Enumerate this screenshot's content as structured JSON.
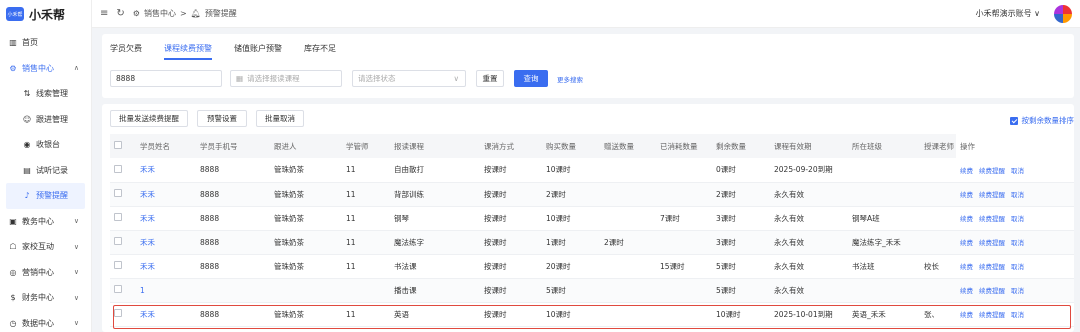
{
  "app": {
    "logo_mark": "小禾帮",
    "name": "小禾帮"
  },
  "sidebar": {
    "items": [
      {
        "label": "首页",
        "icon": "chart-icon"
      },
      {
        "label": "销售中心",
        "icon": "gear-icon",
        "expanded": true
      },
      {
        "label": "线索管理",
        "icon": "clue-icon"
      },
      {
        "label": "跟进管理",
        "icon": "user-icon"
      },
      {
        "label": "收银台",
        "icon": "cashier-icon"
      },
      {
        "label": "试听记录",
        "icon": "record-icon"
      },
      {
        "label": "预警提醒",
        "icon": "bell-icon",
        "active": true
      },
      {
        "label": "教务中心",
        "icon": "book-icon"
      },
      {
        "label": "家校互动",
        "icon": "chat-icon"
      },
      {
        "label": "营销中心",
        "icon": "marketing-icon"
      },
      {
        "label": "财务中心",
        "icon": "finance-icon"
      },
      {
        "label": "数据中心",
        "icon": "data-icon"
      }
    ]
  },
  "topbar": {
    "breadcrumb": [
      "销售中心",
      ">",
      "预警提醒"
    ],
    "account": "小禾帮演示账号 ∨"
  },
  "tabs": [
    "学员欠费",
    "课程续费预警",
    "储值账户预警",
    "库存不足"
  ],
  "active_tab": "课程续费预警",
  "filters": {
    "keyword_value": "8888",
    "course_placeholder": "请选择报读课程",
    "status_placeholder": "请选择状态",
    "reset_label": "重置",
    "search_label": "查询",
    "more_label": "更多搜索"
  },
  "actions": {
    "batch_send": "批量发送续费提醒",
    "warning_settings": "预警设置",
    "batch_cancel": "批量取消",
    "sort_label": "按剩余数量排序"
  },
  "table": {
    "columns": [
      "学员姓名",
      "学员手机号",
      "跟进人",
      "学管师",
      "报读课程",
      "课消方式",
      "购买数量",
      "赠送数量",
      "已消耗数量",
      "剩余数量",
      "课程有效期",
      "所在班级",
      "授课老师",
      "操作"
    ],
    "rows": [
      {
        "name": "禾禾",
        "phone": "8888",
        "follower": "管珠奶茶",
        "manager": "11",
        "course": "自由散打",
        "mode": "按课时",
        "bought": "10课时",
        "gift": "",
        "used": "",
        "left": "0课时",
        "valid": "2025-09-20到期",
        "class": "",
        "teacher": ""
      },
      {
        "name": "禾禾",
        "phone": "8888",
        "follower": "管珠奶茶",
        "manager": "11",
        "course": "背部训练",
        "mode": "按课时",
        "bought": "2课时",
        "gift": "",
        "used": "",
        "left": "2课时",
        "valid": "永久有效",
        "class": "",
        "teacher": ""
      },
      {
        "name": "禾禾",
        "phone": "8888",
        "follower": "管珠奶茶",
        "manager": "11",
        "course": "钢琴",
        "mode": "按课时",
        "bought": "10课时",
        "gift": "",
        "used": "7课时",
        "left": "3课时",
        "valid": "永久有效",
        "class": "钢琴A班",
        "teacher": ""
      },
      {
        "name": "禾禾",
        "phone": "8888",
        "follower": "管珠奶茶",
        "manager": "11",
        "course": "魔法练字",
        "mode": "按课时",
        "bought": "1课时",
        "gift": "2课时",
        "used": "",
        "left": "3课时",
        "valid": "永久有效",
        "class": "魔法练字_禾禾",
        "teacher": ""
      },
      {
        "name": "禾禾",
        "phone": "8888",
        "follower": "管珠奶茶",
        "manager": "11",
        "course": "书法课",
        "mode": "按课时",
        "bought": "20课时",
        "gift": "",
        "used": "15课时",
        "left": "5课时",
        "valid": "永久有效",
        "class": "书法班",
        "teacher": "校长"
      },
      {
        "name": "1",
        "phone": "",
        "follower": "",
        "manager": "",
        "course": "播击课",
        "mode": "按课时",
        "bought": "5课时",
        "gift": "",
        "used": "",
        "left": "5课时",
        "valid": "永久有效",
        "class": "",
        "teacher": ""
      },
      {
        "name": "禾禾",
        "phone": "8888",
        "follower": "管珠奶茶",
        "manager": "11",
        "course": "英语",
        "mode": "按课时",
        "bought": "10课时",
        "gift": "",
        "used": "",
        "left": "10课时",
        "valid": "2025-10-01到期",
        "class": "英语_禾禾",
        "teacher": "张、"
      }
    ],
    "row_ops": [
      "续费",
      "续费提醒",
      "取消"
    ]
  },
  "colors": {
    "accent": "#3a6df0",
    "highlight": "#e04a3f"
  }
}
